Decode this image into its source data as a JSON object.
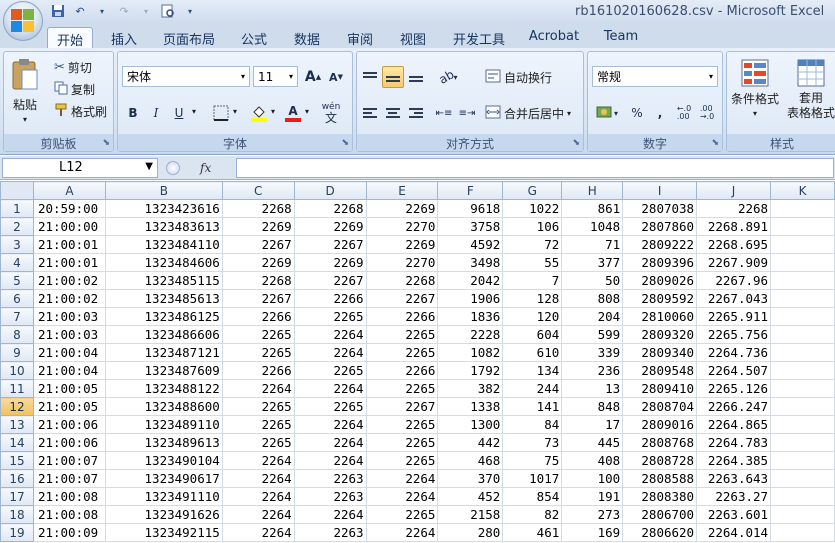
{
  "titlebar": {
    "title": "rb161020160628.csv - Microsoft Excel"
  },
  "tabs": [
    "开始",
    "插入",
    "页面布局",
    "公式",
    "数据",
    "审阅",
    "视图",
    "开发工具",
    "Acrobat",
    "Team"
  ],
  "ribbon": {
    "clipboard": {
      "paste": "粘贴",
      "cut": "剪切",
      "copy": "复制",
      "format_painter": "格式刷",
      "label": "剪贴板"
    },
    "font": {
      "name": "宋体",
      "size": "11",
      "grow": "A",
      "shrink": "A",
      "bold": "B",
      "italic": "I",
      "underline": "U",
      "phonetic": "wén",
      "label": "字体"
    },
    "alignment": {
      "wrap": "自动换行",
      "merge": "合并后居中",
      "label": "对齐方式"
    },
    "number": {
      "format": "常规",
      "percent": "%",
      "comma": ",",
      "label": "数字"
    },
    "styles": {
      "conditional": "条件格式",
      "table_line1": "套用",
      "table_line2": "表格格式",
      "label": "样式"
    }
  },
  "formula_bar": {
    "name_box": "L12",
    "fx": "fx",
    "value": ""
  },
  "grid": {
    "columns": [
      "A",
      "B",
      "C",
      "D",
      "E",
      "F",
      "G",
      "H",
      "I",
      "J",
      "K"
    ],
    "selected_row": 12,
    "rows": [
      {
        "n": "1",
        "cells": [
          "20:59:00",
          "1323423616",
          "2268",
          "2268",
          "2269",
          "9618",
          "1022",
          "861",
          "2807038",
          "2268"
        ]
      },
      {
        "n": "2",
        "cells": [
          "21:00:00",
          "1323483613",
          "2269",
          "2269",
          "2270",
          "3758",
          "106",
          "1048",
          "2807860",
          "2268.891"
        ]
      },
      {
        "n": "3",
        "cells": [
          "21:00:01",
          "1323484110",
          "2267",
          "2267",
          "2269",
          "4592",
          "72",
          "71",
          "2809222",
          "2268.695"
        ]
      },
      {
        "n": "4",
        "cells": [
          "21:00:01",
          "1323484606",
          "2269",
          "2269",
          "2270",
          "3498",
          "55",
          "377",
          "2809396",
          "2267.909"
        ]
      },
      {
        "n": "5",
        "cells": [
          "21:00:02",
          "1323485115",
          "2268",
          "2267",
          "2268",
          "2042",
          "7",
          "50",
          "2809026",
          "2267.96"
        ]
      },
      {
        "n": "6",
        "cells": [
          "21:00:02",
          "1323485613",
          "2267",
          "2266",
          "2267",
          "1906",
          "128",
          "808",
          "2809592",
          "2267.043"
        ]
      },
      {
        "n": "7",
        "cells": [
          "21:00:03",
          "1323486125",
          "2266",
          "2265",
          "2266",
          "1836",
          "120",
          "204",
          "2810060",
          "2265.911"
        ]
      },
      {
        "n": "8",
        "cells": [
          "21:00:03",
          "1323486606",
          "2265",
          "2264",
          "2265",
          "2228",
          "604",
          "599",
          "2809320",
          "2265.756"
        ]
      },
      {
        "n": "9",
        "cells": [
          "21:00:04",
          "1323487121",
          "2265",
          "2264",
          "2265",
          "1082",
          "610",
          "339",
          "2809340",
          "2264.736"
        ]
      },
      {
        "n": "10",
        "cells": [
          "21:00:04",
          "1323487609",
          "2266",
          "2265",
          "2266",
          "1792",
          "134",
          "236",
          "2809548",
          "2264.507"
        ]
      },
      {
        "n": "11",
        "cells": [
          "21:00:05",
          "1323488122",
          "2264",
          "2264",
          "2265",
          "382",
          "244",
          "13",
          "2809410",
          "2265.126"
        ]
      },
      {
        "n": "12",
        "cells": [
          "21:00:05",
          "1323488600",
          "2265",
          "2265",
          "2267",
          "1338",
          "141",
          "848",
          "2808704",
          "2266.247"
        ]
      },
      {
        "n": "13",
        "cells": [
          "21:00:06",
          "1323489110",
          "2265",
          "2264",
          "2265",
          "1300",
          "84",
          "17",
          "2809016",
          "2264.865"
        ]
      },
      {
        "n": "14",
        "cells": [
          "21:00:06",
          "1323489613",
          "2265",
          "2264",
          "2265",
          "442",
          "73",
          "445",
          "2808768",
          "2264.783"
        ]
      },
      {
        "n": "15",
        "cells": [
          "21:00:07",
          "1323490104",
          "2264",
          "2264",
          "2265",
          "468",
          "75",
          "408",
          "2808728",
          "2264.385"
        ]
      },
      {
        "n": "16",
        "cells": [
          "21:00:07",
          "1323490617",
          "2264",
          "2263",
          "2264",
          "370",
          "1017",
          "100",
          "2808588",
          "2263.643"
        ]
      },
      {
        "n": "17",
        "cells": [
          "21:00:08",
          "1323491110",
          "2264",
          "2263",
          "2264",
          "452",
          "854",
          "191",
          "2808380",
          "2263.27"
        ]
      },
      {
        "n": "18",
        "cells": [
          "21:00:08",
          "1323491626",
          "2264",
          "2264",
          "2265",
          "2158",
          "82",
          "273",
          "2806700",
          "2263.601"
        ]
      },
      {
        "n": "19",
        "cells": [
          "21:00:09",
          "1323492115",
          "2264",
          "2263",
          "2264",
          "280",
          "461",
          "169",
          "2806620",
          "2264.014"
        ]
      }
    ]
  }
}
